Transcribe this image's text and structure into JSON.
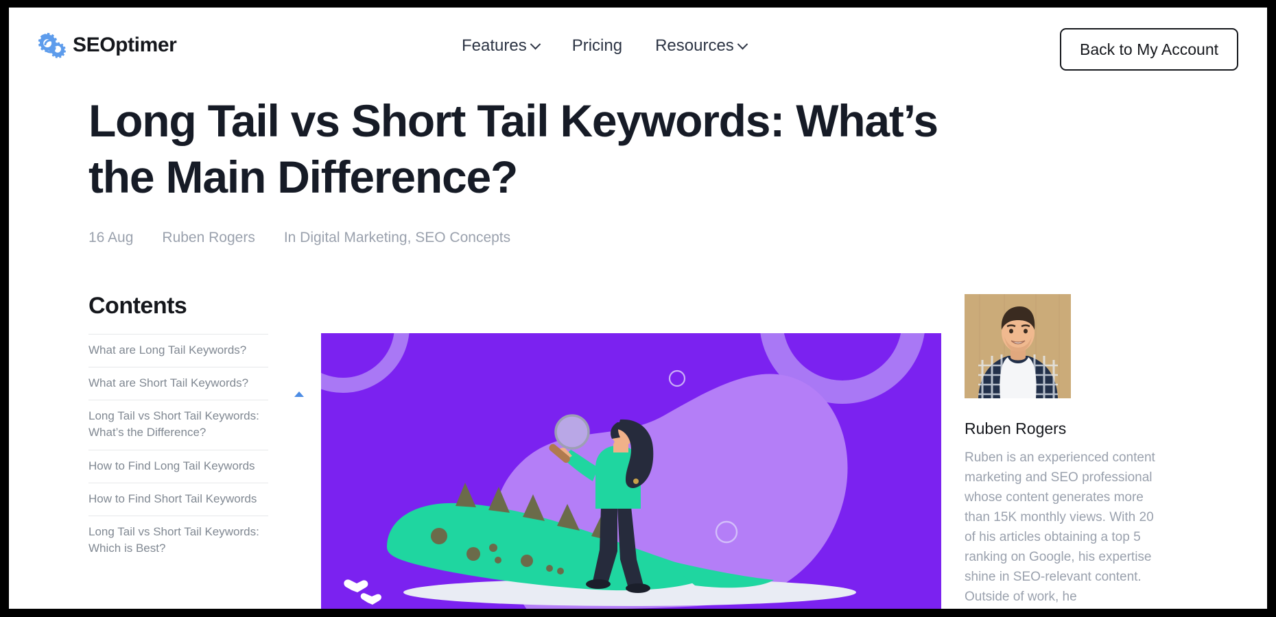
{
  "brand": {
    "name": "SEOptimer",
    "logo_icon": "gear-refresh-icon",
    "logo_color": "#5d9cec"
  },
  "header": {
    "nav": [
      {
        "label": "Features",
        "has_dropdown": true,
        "icon": "chevron-down-icon"
      },
      {
        "label": "Pricing",
        "has_dropdown": false,
        "icon": ""
      },
      {
        "label": "Resources",
        "has_dropdown": true,
        "icon": "chevron-down-icon"
      }
    ],
    "account_button": "Back to My Account"
  },
  "article": {
    "title": "Long Tail vs Short Tail Keywords: What’s the Main Difference?",
    "date": "16 Aug",
    "author": "Ruben Rogers",
    "categories_prefix": "In",
    "categories": "Digital Marketing, SEO Concepts",
    "categories_full": "In Digital Marketing, SEO Concepts"
  },
  "contents": {
    "heading": "Contents",
    "collapse_icon": "caret-up-icon",
    "items": [
      {
        "label": "What are Long Tail Keywords?"
      },
      {
        "label": "What are Short Tail Keywords?"
      },
      {
        "label": "Long Tail vs Short Tail Keywords: What’s the Difference?"
      },
      {
        "label": "How to Find Long Tail Keywords"
      },
      {
        "label": "How to Find Short Tail Keywords"
      },
      {
        "label": "Long Tail vs Short Tail Keywords: Which is Best?"
      }
    ]
  },
  "hero": {
    "alt": "Illustration of a woman with a magnifying glass standing beside a large green crocodile on a purple background",
    "background_color": "#7b22f0",
    "blob_color": "#b47ef7",
    "crocodile_color": "#1fd6a0",
    "spike_color": "#6b6b4a",
    "ground_color": "#e9ecf4",
    "person": {
      "hair_color": "#262b3c",
      "sweater_color": "#1fd6a0",
      "pants_color": "#262b3c",
      "skin_color": "#f0b189"
    }
  },
  "author_card": {
    "photo_alt": "Ruben Rogers portrait",
    "name": "Ruben Rogers",
    "bio": "Ruben is an experienced content marketing and SEO professional whose content generates more than 15K monthly views. With 20 of his articles obtaining a top 5 ranking on Google, his expertise shine in SEO-relevant content. Outside of work, he"
  },
  "colors": {
    "text_dark": "#15171c",
    "text_muted": "#9aa1ad",
    "divider": "#e6e8ea",
    "accent_blue": "#4c8ce4",
    "purple": "#7b22f0"
  }
}
